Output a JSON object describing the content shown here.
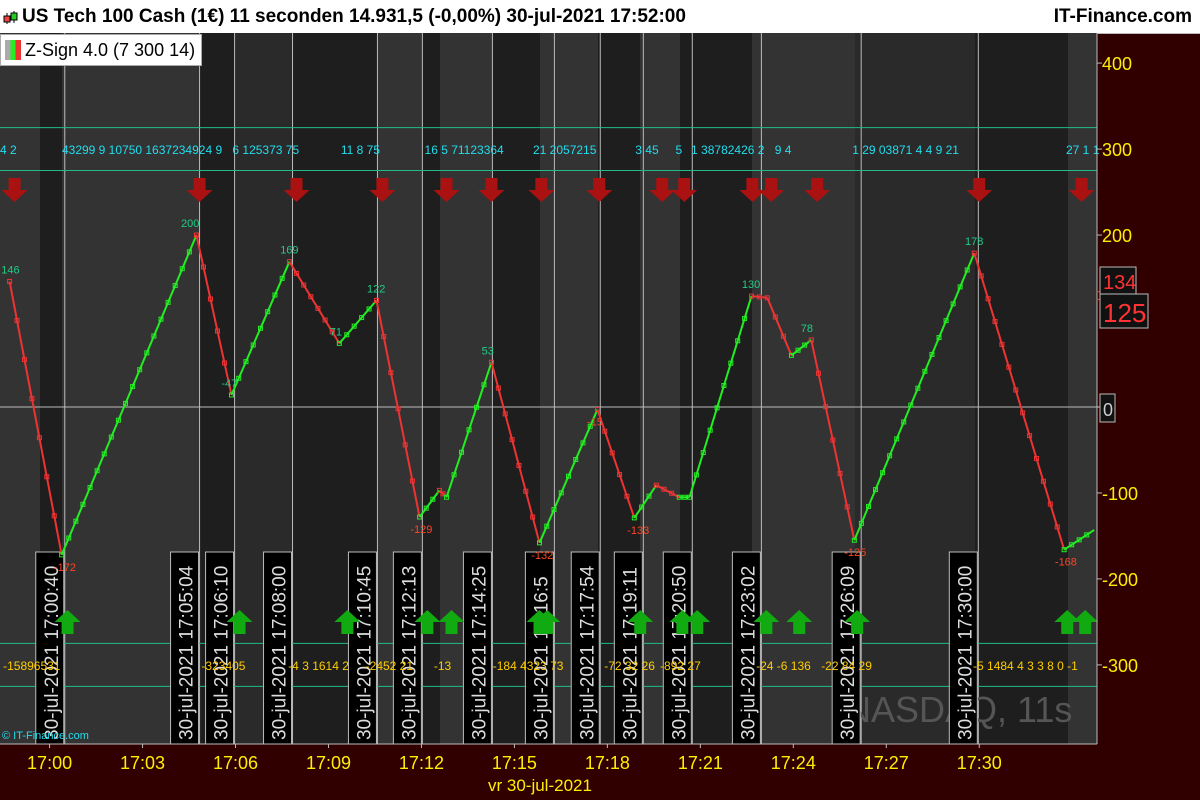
{
  "header": {
    "title": "US Tech 100 Cash (1€) 11 seconden 14.931,5 (-0,00%) 30-jul-2021 17:52:00",
    "site": "IT-Finance.com",
    "indicator": "Z-Sign 4.0 (7 300 14)",
    "copyright": "© IT-Finance.com",
    "watermark": "NASDAQ, 11s"
  },
  "colors": {
    "up": "#22ee22",
    "down": "#ee3333",
    "axis_text": "#ffee00",
    "band_line": "#22bb88",
    "axis_bg": "#300000"
  },
  "chart_data": {
    "type": "line",
    "title": "Z-Sign 4.0 (7 300 14)",
    "xlabel": "vr 30-jul-2021",
    "ylabel": "",
    "x_unit": "minutes after 17:00",
    "xlim": [
      -1.6,
      33.8
    ],
    "ylim": [
      -392,
      435
    ],
    "grid": true,
    "x_ticks": [
      {
        "label": "17:00",
        "x": 0
      },
      {
        "label": "17:03",
        "x": 3
      },
      {
        "label": "17:06",
        "x": 6
      },
      {
        "label": "17:09",
        "x": 9
      },
      {
        "label": "17:12",
        "x": 12
      },
      {
        "label": "17:15",
        "x": 15
      },
      {
        "label": "17:18",
        "x": 18
      },
      {
        "label": "17:21",
        "x": 21
      },
      {
        "label": "17:24",
        "x": 24
      },
      {
        "label": "17:27",
        "x": 27
      },
      {
        "label": "17:30",
        "x": 30
      }
    ],
    "y_ticks": [
      400,
      300,
      200,
      -100,
      -200,
      -300
    ],
    "levels": [
      325,
      275,
      -275,
      -325
    ],
    "markers": [
      {
        "label": "134",
        "value": 134,
        "color": "#ff3333"
      },
      {
        "label": "125",
        "value": 125,
        "color": "#ff3333"
      },
      {
        "label": "0",
        "value": 0,
        "color": "#cccccc"
      }
    ],
    "series": [
      {
        "name": "Z-Sign",
        "points": [
          [
            -1.29,
            146
          ],
          [
            0.39,
            -172
          ],
          [
            4.74,
            200
          ],
          [
            5.87,
            14
          ],
          [
            7.74,
            169
          ],
          [
            9.35,
            74
          ],
          [
            10.55,
            124
          ],
          [
            11.94,
            -128
          ],
          [
            12.58,
            -97
          ],
          [
            12.81,
            -105
          ],
          [
            14.26,
            52
          ],
          [
            15.81,
            -158
          ],
          [
            17.68,
            -3
          ],
          [
            18.87,
            -129
          ],
          [
            19.58,
            -91
          ],
          [
            20.32,
            -105
          ],
          [
            20.65,
            -105
          ],
          [
            22.65,
            129
          ],
          [
            23.16,
            127
          ],
          [
            23.94,
            60
          ],
          [
            24.58,
            78
          ],
          [
            25.97,
            -155
          ],
          [
            29.84,
            179
          ],
          [
            32.74,
            -166
          ],
          [
            33.71,
            -143
          ]
        ]
      }
    ],
    "value_labels": [
      {
        "x": -1.3,
        "y": 146,
        "text": "146"
      },
      {
        "x": 0.4,
        "y": -172,
        "text": "-172"
      },
      {
        "x": 4.5,
        "y": 200,
        "text": "200"
      },
      {
        "x": 5.8,
        "y": 14,
        "text": "-47"
      },
      {
        "x": 7.7,
        "y": 169,
        "text": "169"
      },
      {
        "x": 9.3,
        "y": 74,
        "text": "71"
      },
      {
        "x": 10.5,
        "y": 124,
        "text": "122"
      },
      {
        "x": 11.9,
        "y": -128,
        "text": "-129"
      },
      {
        "x": 14.2,
        "y": 52,
        "text": "53"
      },
      {
        "x": 15.8,
        "y": -158,
        "text": "-132"
      },
      {
        "x": 17.6,
        "y": -3,
        "text": "-15"
      },
      {
        "x": 18.9,
        "y": -129,
        "text": "-133"
      },
      {
        "x": 22.6,
        "y": 129,
        "text": "130"
      },
      {
        "x": 24.5,
        "y": 78,
        "text": "78"
      },
      {
        "x": 25.9,
        "y": -155,
        "text": "-125"
      },
      {
        "x": 29.8,
        "y": 179,
        "text": "178"
      },
      {
        "x": 32.7,
        "y": -166,
        "text": "-168"
      }
    ],
    "sell_arrows": [
      -1.13,
      4.84,
      7.97,
      10.74,
      12.81,
      14.26,
      15.87,
      17.74,
      19.77,
      20.48,
      22.68,
      23.29,
      24.77,
      30.0,
      33.3
    ],
    "buy_arrows": [
      0.58,
      6.13,
      9.61,
      12.19,
      12.97,
      15.81,
      16.06,
      19.06,
      20.42,
      20.9,
      23.13,
      24.19,
      26.06,
      32.84,
      33.42
    ],
    "date_labels": [
      {
        "x": 0.49,
        "text": "30-jul-2021  17:00:40"
      },
      {
        "x": 4.84,
        "text": "30-jul-2021  17:05:04"
      },
      {
        "x": 5.97,
        "text": "30-jul-2021  17:06:10"
      },
      {
        "x": 7.84,
        "text": "30-jul-2021  17:08:00"
      },
      {
        "x": 10.58,
        "text": "30-jul-2021  17:10:45"
      },
      {
        "x": 12.03,
        "text": "30-jul-2021  17:12:13"
      },
      {
        "x": 14.29,
        "text": "30-jul-2021  17:14:25"
      },
      {
        "x": 16.29,
        "text": "30-jul-2021  17:16:5"
      },
      {
        "x": 17.77,
        "text": "30-jul-2021  17:17:54"
      },
      {
        "x": 19.16,
        "text": "30-jul-2021  17:19:11"
      },
      {
        "x": 20.74,
        "text": "30-jul-2021  17:20:50"
      },
      {
        "x": 22.97,
        "text": "30-jul-2021  17:23:02"
      },
      {
        "x": 26.19,
        "text": "30-jul-2021  17:26:09"
      },
      {
        "x": 29.97,
        "text": "30-jul-2021  17:30:00"
      }
    ],
    "top_counts": [
      {
        "x": -1.6,
        "text": "4 2"
      },
      {
        "x": 0.4,
        "text": "43299 9 10750 1637234924 9"
      },
      {
        "x": 5.9,
        "text": "6 125373 75"
      },
      {
        "x": 9.4,
        "text": "11 8 75"
      },
      {
        "x": 12.1,
        "text": "16 5 71123364"
      },
      {
        "x": 15.6,
        "text": "21 2057215"
      },
      {
        "x": 18.9,
        "text": "3 45"
      },
      {
        "x": 20.2,
        "text": "5"
      },
      {
        "x": 20.7,
        "text": "1 38782426 2"
      },
      {
        "x": 23.4,
        "text": "9 4"
      },
      {
        "x": 25.9,
        "text": "1 29 03871 4 4 9 21"
      },
      {
        "x": 32.8,
        "text": "27 1 1"
      }
    ],
    "bottom_counts": [
      {
        "x": -1.5,
        "text": "-15896531"
      },
      {
        "x": 4.9,
        "text": "-323405"
      },
      {
        "x": 7.7,
        "text": "-4 3 1614 2"
      },
      {
        "x": 10.2,
        "text": "-2452 21"
      },
      {
        "x": 12.4,
        "text": "-13"
      },
      {
        "x": 14.3,
        "text": "-184 4323 73"
      },
      {
        "x": 17.9,
        "text": "-72 32 26"
      },
      {
        "x": 19.7,
        "text": "-892 27"
      },
      {
        "x": 22.8,
        "text": "-24 -6 136"
      },
      {
        "x": 24.9,
        "text": "-22 84 29"
      },
      {
        "x": 29.8,
        "text": "-5 1484 4 3 3 8 0 -1"
      }
    ]
  }
}
